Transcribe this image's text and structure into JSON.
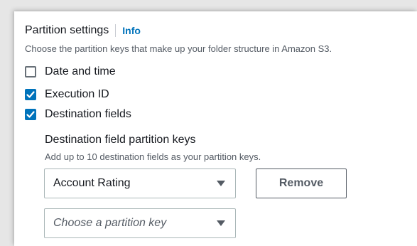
{
  "section": {
    "title": "Partition settings",
    "info_label": "Info",
    "description": "Choose the partition keys that make up your folder structure in Amazon S3."
  },
  "options": [
    {
      "label": "Date and time",
      "checked": false
    },
    {
      "label": "Execution ID",
      "checked": true
    },
    {
      "label": "Destination fields",
      "checked": true
    }
  ],
  "destination_keys": {
    "title": "Destination field partition keys",
    "description": "Add up to 10 destination fields as your partition keys.",
    "selected_key": "Account Rating",
    "remove_label": "Remove",
    "new_key_placeholder": "Choose a partition key"
  },
  "colors": {
    "accent": "#0073bb",
    "text": "#16191f",
    "muted": "#545b64"
  }
}
